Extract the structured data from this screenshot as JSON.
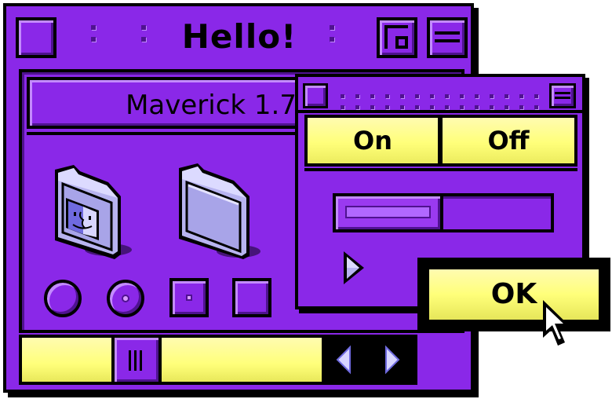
{
  "main_window": {
    "title": "Hello!",
    "version_label": "Maverick 1.7"
  },
  "folders": [
    {
      "name": "system-folder-icon"
    },
    {
      "name": "folder-icon"
    }
  ],
  "controls_row": [
    {
      "type": "radio",
      "state": "off"
    },
    {
      "type": "radio",
      "state": "on"
    },
    {
      "type": "checkbox",
      "state": "on"
    },
    {
      "type": "checkbox",
      "state": "off"
    }
  ],
  "scrollbar": {
    "thumb_position": 0.36,
    "left_arrow": "◀",
    "right_arrow": "▶"
  },
  "sub_window": {
    "segmented": {
      "on_label": "On",
      "off_label": "Off"
    },
    "progress": 0.5,
    "disclosure_icon": "triangle-right-icon"
  },
  "ok_button": {
    "label": "OK"
  },
  "colors": {
    "window": "#8a28e8",
    "window_shadow": "#4f1290",
    "window_highlight": "#c38bff",
    "button_yellow": "#ffff7a",
    "folder": "#b8b4f0"
  }
}
